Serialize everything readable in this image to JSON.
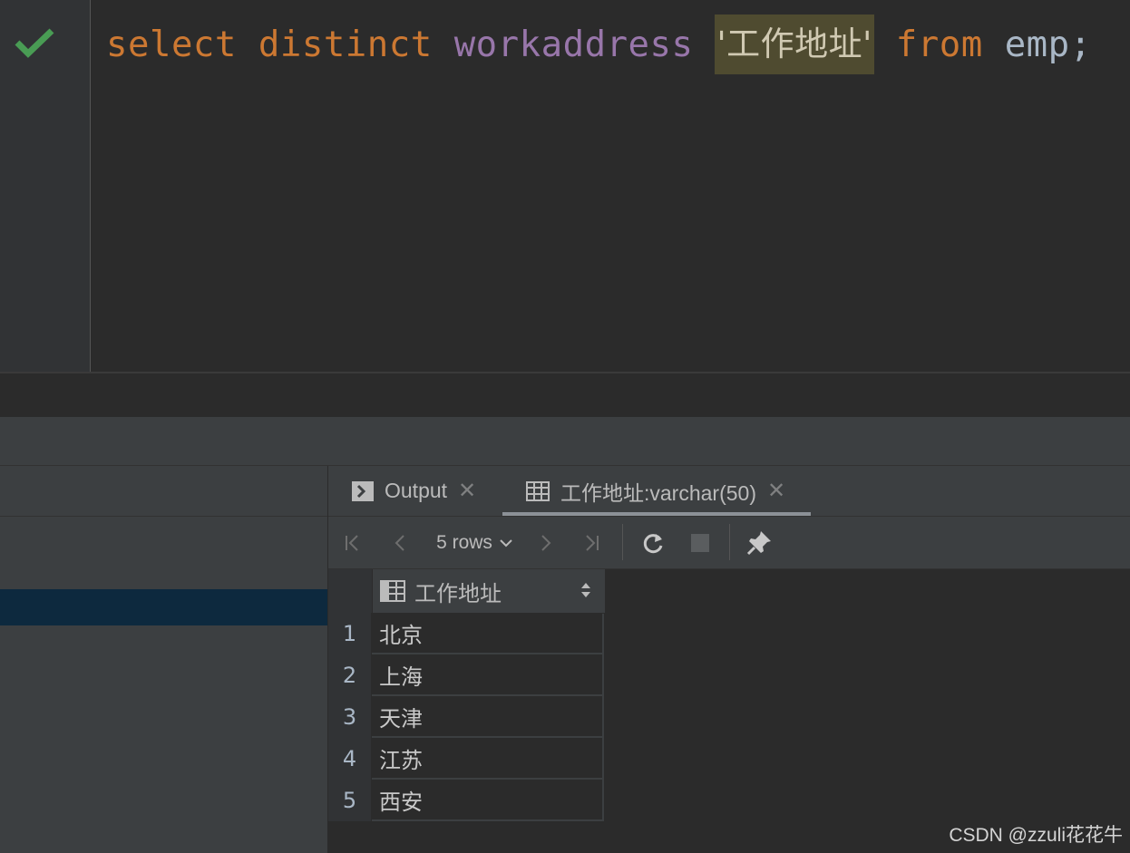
{
  "editor": {
    "tokens": {
      "select": "select",
      "distinct": "distinct",
      "column": "workaddress",
      "alias": "'工作地址'",
      "from": "from",
      "table": "emp;"
    }
  },
  "results": {
    "tabs": [
      {
        "label": "Output",
        "icon": "console-icon"
      },
      {
        "label": "工作地址:varchar(50)",
        "icon": "table-icon"
      }
    ],
    "toolbar": {
      "rows_label": "5 rows"
    },
    "column_header": "工作地址",
    "rows": [
      {
        "num": "1",
        "value": "北京"
      },
      {
        "num": "2",
        "value": "上海"
      },
      {
        "num": "3",
        "value": "天津"
      },
      {
        "num": "4",
        "value": "江苏"
      },
      {
        "num": "5",
        "value": "西安"
      }
    ]
  },
  "watermark": "CSDN @zzuli花花牛",
  "colors": {
    "keyword": "#cc7832",
    "column": "#9876aa",
    "string_bg": "#4f4b30",
    "check": "#499c54"
  }
}
